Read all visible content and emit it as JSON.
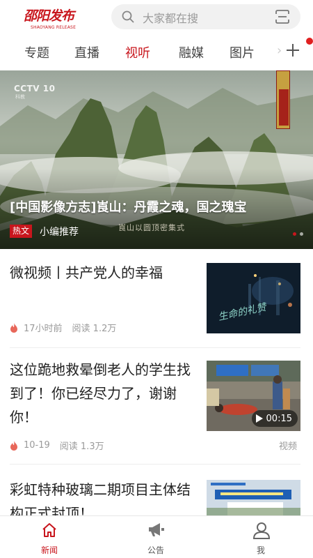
{
  "header": {
    "logo_text": "邵阳发布",
    "logo_sub": "SHAOYANG RELEASE",
    "search_placeholder": "大家都在搜"
  },
  "tabs": [
    {
      "label": "专题",
      "active": false
    },
    {
      "label": "直播",
      "active": false
    },
    {
      "label": "视听",
      "active": true
    },
    {
      "label": "融媒",
      "active": false
    },
    {
      "label": "图片",
      "active": false
    }
  ],
  "banner": {
    "channel": "CCTV 10",
    "channel_sub": "科教",
    "title": "[中国影像方志]崀山：丹霞之魂，国之瑰宝",
    "tag": "热文",
    "subtitle": "小编推荐",
    "caption": "崀山以圆顶密集式",
    "seal_text": "崀山记"
  },
  "news": [
    {
      "title": "微视频丨共产党人的幸福",
      "time": "17小时前",
      "reads": "阅读 1.2万",
      "thumb_text": "生命的礼赞"
    },
    {
      "title": "这位跪地救晕倒老人的学生找到了！你已经尽力了，谢谢你！",
      "time": "10-19",
      "reads": "阅读 1.3万",
      "duration": "00:15",
      "type_label": "视频"
    },
    {
      "title": "彩虹特种玻璃二期项目主体结构正式封顶！"
    }
  ],
  "bottom_nav": [
    {
      "label": "新闻",
      "active": true
    },
    {
      "label": "公告",
      "active": false
    },
    {
      "label": "我",
      "active": false
    }
  ],
  "colors": {
    "accent": "#c8161d",
    "muted": "#9a9a9a",
    "search_bg": "#f1f1f1"
  }
}
